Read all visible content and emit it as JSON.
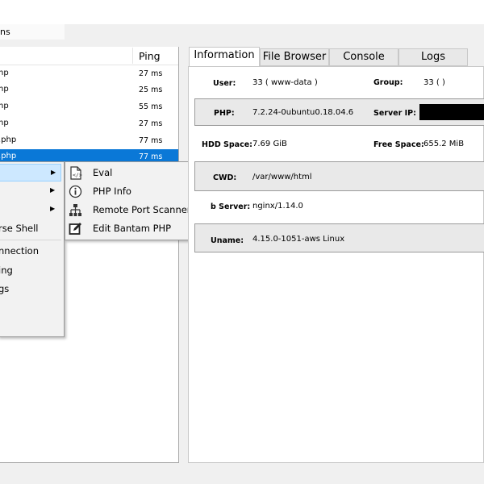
{
  "menubar": {
    "partial_label": "ns"
  },
  "sessions": {
    "ping_header": "Ping",
    "rows": [
      {
        "name": "np",
        "ping": "27 ms"
      },
      {
        "name": "np",
        "ping": "25 ms"
      },
      {
        "name": "np",
        "ping": "55 ms"
      },
      {
        "name": "np",
        "ping": "27 ms"
      },
      {
        "name": ".php",
        "ping": "77 ms"
      },
      {
        "name": ".php",
        "ping": "77 ms"
      }
    ]
  },
  "context_menu": {
    "items": [
      {
        "label": "",
        "has_submenu": true
      },
      {
        "label": "",
        "has_submenu": true
      },
      {
        "label": "",
        "has_submenu": true
      },
      {
        "label": "rse Shell",
        "has_submenu": false
      },
      {
        "label": "nnection",
        "has_submenu": false
      },
      {
        "label": "ing",
        "has_submenu": false
      },
      {
        "label": "gs",
        "has_submenu": false
      },
      {
        "label": "",
        "has_submenu": false
      }
    ]
  },
  "submenu": {
    "items": [
      {
        "label": "Eval",
        "icon": "code-file-icon"
      },
      {
        "label": "PHP Info",
        "icon": "info-icon"
      },
      {
        "label": "Remote Port Scanner",
        "icon": "network-tree-icon"
      },
      {
        "label": "Edit Bantam PHP",
        "icon": "edit-icon"
      }
    ]
  },
  "tabs": [
    {
      "label": "Information",
      "active": true
    },
    {
      "label": "File Browser",
      "active": false
    },
    {
      "label": "Console",
      "active": false
    },
    {
      "label": "Logs",
      "active": false
    }
  ],
  "info": {
    "user_label": "User:",
    "user_value": "33 ( www-data )",
    "group_label": "Group:",
    "group_value": "33 ( )",
    "php_label": "PHP:",
    "php_value": "7.2.24-0ubuntu0.18.04.6",
    "server_ip_label": "Server IP:",
    "server_ip_value": "",
    "hdd_label": "HDD Space:",
    "hdd_value": "7.69 GiB",
    "free_label": "Free Space:",
    "free_value": "655.2 MiB",
    "cwd_label": "CWD:",
    "cwd_value": "/var/www/html",
    "webserver_label": "b Server:",
    "webserver_value": "nginx/1.14.0",
    "uname_label": "Uname:",
    "uname_value": "4.15.0-1051-aws Linux"
  }
}
